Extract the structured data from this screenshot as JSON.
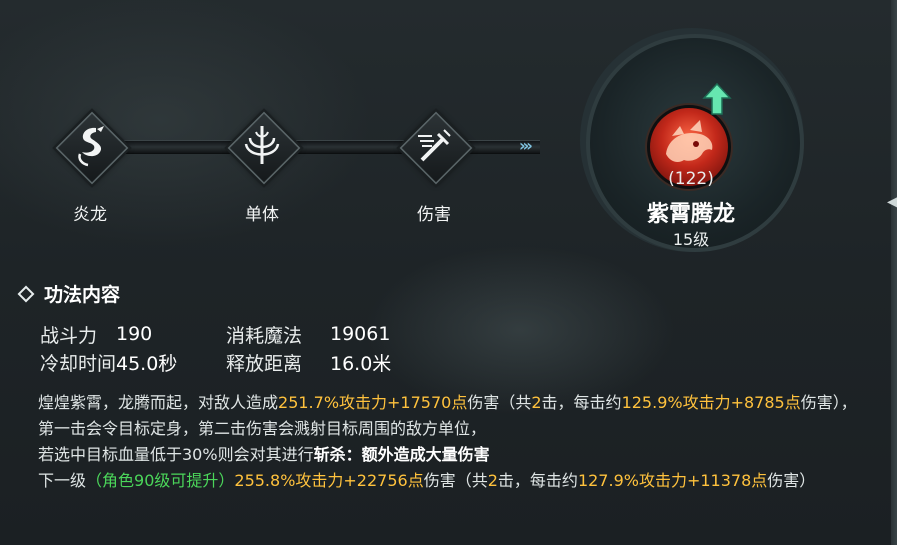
{
  "chain": {
    "nodes": [
      {
        "label": "炎龙",
        "icon": "dragon-icon"
      },
      {
        "label": "单体",
        "icon": "single-target-icon"
      },
      {
        "label": "伤害",
        "icon": "damage-icon"
      }
    ],
    "arrows": "›››"
  },
  "badge": {
    "count": "(122)",
    "name": "紫霄腾龙",
    "level": "15级",
    "icon": "red-dragon-head-icon",
    "upgrade_icon": "green-up-arrow-icon"
  },
  "details": {
    "section_title": "功法内容",
    "stats": {
      "power_label": "战斗力",
      "power_value": "190",
      "mana_label": "消耗魔法",
      "mana_value": "19061",
      "cooldown_label": "冷却时间",
      "cooldown_value": "45.0秒",
      "range_label": "释放距离",
      "range_value": "16.0米"
    },
    "description": {
      "p1_a": "煌煌紫霄，龙腾而起，对敌人造成",
      "p1_hl1": "251.7%攻击力+17570点",
      "p1_b": "伤害（共",
      "p1_hits": "2",
      "p1_c": "击，每击约",
      "p1_hl2": "125.9%攻击力+8785点",
      "p1_d": "伤害），第一击会令目标定身，第二击伤害会溅射目标周围的敌方单位，",
      "p1_e": "若选中目标血量低于30%则会对其进行",
      "p1_execute": "斩杀：额外造成大量伤害",
      "next_label": "下一级",
      "next_req": "（角色90级可提升）",
      "next_hl1": "255.8%攻击力+22756点",
      "next_b": "伤害（共",
      "next_hits": "2",
      "next_c": "击，每击约",
      "next_hl2": "127.9%攻击力+11378点",
      "next_d": "伤害）"
    }
  },
  "colors": {
    "highlight": "#ffc23d",
    "green": "#4bd65a",
    "arrow_blue": "#7fc3e0"
  }
}
